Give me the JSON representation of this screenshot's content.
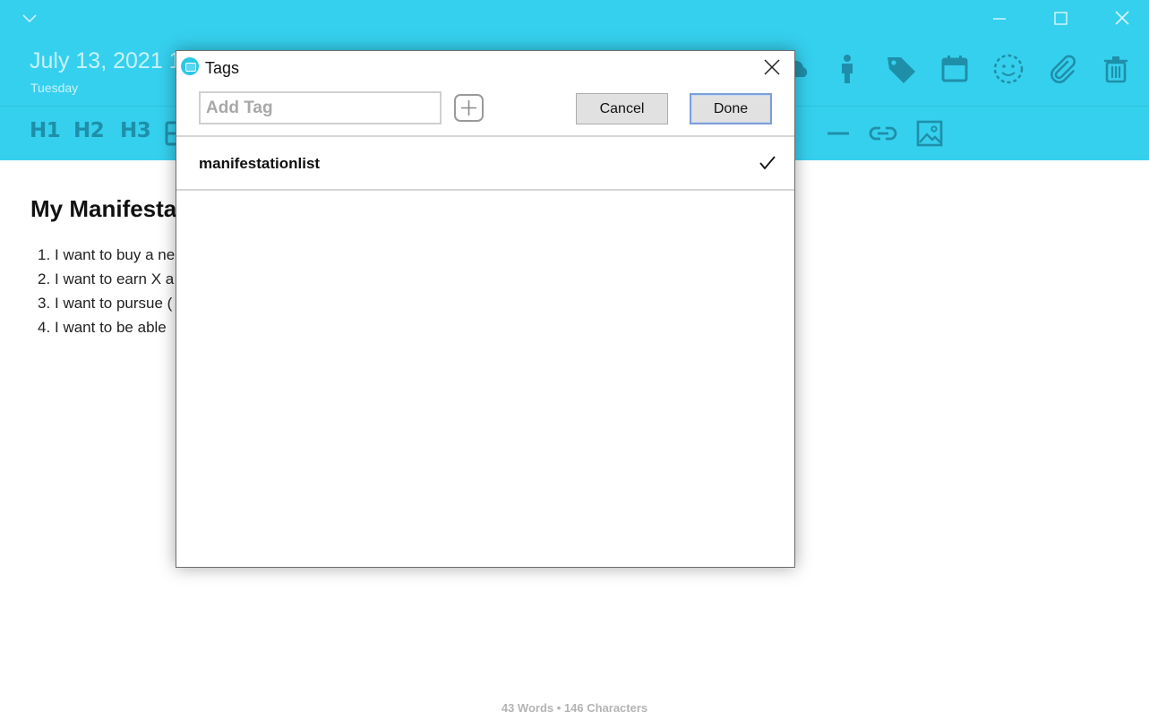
{
  "header": {
    "date": "July 13, 2021 1:(",
    "day": "Tuesday",
    "accent_color": "#35d0ee",
    "toolbar_icons": [
      "cloud-icon",
      "person-icon",
      "tag-icon",
      "calendar-icon",
      "mood-icon",
      "attachment-icon",
      "trash-icon"
    ]
  },
  "format_toolbar": {
    "h1": "H1",
    "h2": "H2",
    "h3": "H3"
  },
  "document": {
    "title": "My Manifesta",
    "items": [
      {
        "num": "1.",
        "text": "I want to buy a ne"
      },
      {
        "num": "2.",
        "text": "I want to earn X a"
      },
      {
        "num": "3.",
        "text": "I want to pursue ("
      },
      {
        "num": "4.",
        "text": "I want to be able"
      }
    ],
    "word_count": "43 Words • 146 Characters"
  },
  "tags_dialog": {
    "title": "Tags",
    "input_placeholder": "Add Tag",
    "input_value": "",
    "cancel_label": "Cancel",
    "done_label": "Done",
    "tags": [
      {
        "label": "manifestationlist",
        "checked": true
      }
    ]
  }
}
